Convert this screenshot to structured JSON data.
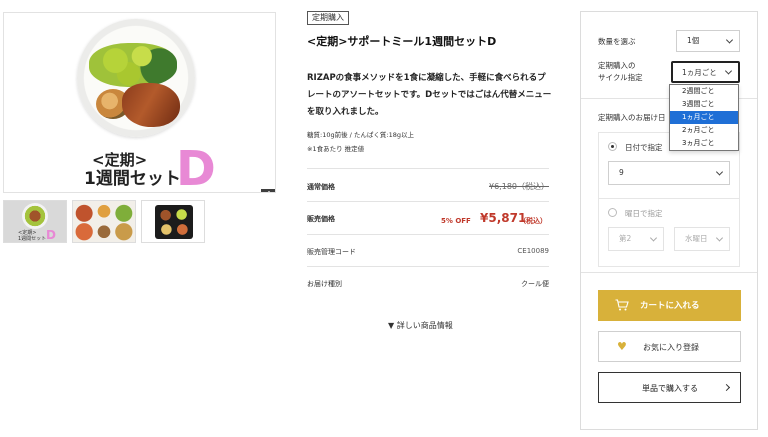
{
  "product": {
    "tag": "定期購入",
    "title": "<定期>サポートミール1週間セットD",
    "description": "RIZAPの食事メソッドを1食に凝縮した、手軽に食べられるプレートのアソートセットです。Dセットではごはん代替メニューを取り入れました。",
    "nutrition_line1": "糖質:10g前後 / たんぱく質:18g以上",
    "nutrition_line2": "※1食あたり 推定値",
    "image_caption_line1": "<定期>",
    "image_caption_line2": "1週間セット",
    "image_caption_letter": "D",
    "thumb1_caption": "<定期>\n1週間セット",
    "thumb1_letter": "D",
    "zoom_label": "+"
  },
  "pricing": {
    "regular_label": "通常価格",
    "regular_value": "¥6,180（税込）",
    "sale_label": "販売価格",
    "discount": "5% OFF",
    "sale_price": "¥5,871",
    "sale_tax": "（税込）",
    "code_label": "販売管理コード",
    "code_value": "CE10089",
    "shipping_label": "お届け種別",
    "shipping_value": "クール便"
  },
  "detail_link": "▼ 詳しい商品情報",
  "panel": {
    "qty_label": "数量を選ぶ",
    "qty_value": "1個",
    "cycle_label_line1": "定期購入の",
    "cycle_label_line2": "サイクル指定",
    "cycle_value": "1ヵ月ごと",
    "delivery_label": "定期購入のお届け日",
    "by_date_label": "日付で指定",
    "day_value": "9",
    "by_weekday_label": "曜日で指定",
    "week_value": "第2",
    "weekday_value": "水曜日",
    "cart_button": "カートに入れる",
    "favorite_button": "お気に入り登録",
    "single_buy_button": "単品で購入する"
  },
  "cycle_options": [
    "2週間ごと",
    "3週間ごと",
    "1ヵ月ごと",
    "2ヵ月ごと",
    "3ヵ月ごと"
  ],
  "cycle_selected_index": 2,
  "colors": {
    "accent_gold": "#d8b13a",
    "price_red": "#c0392b",
    "highlight_blue": "#1f6fd6",
    "letter_pink": "#e889d5"
  },
  "icons": {
    "zoom": "plus-icon",
    "cart": "cart-icon",
    "favorite": "heart-icon",
    "arrow": "chevron-right-icon",
    "select": "chevron-down-icon"
  }
}
